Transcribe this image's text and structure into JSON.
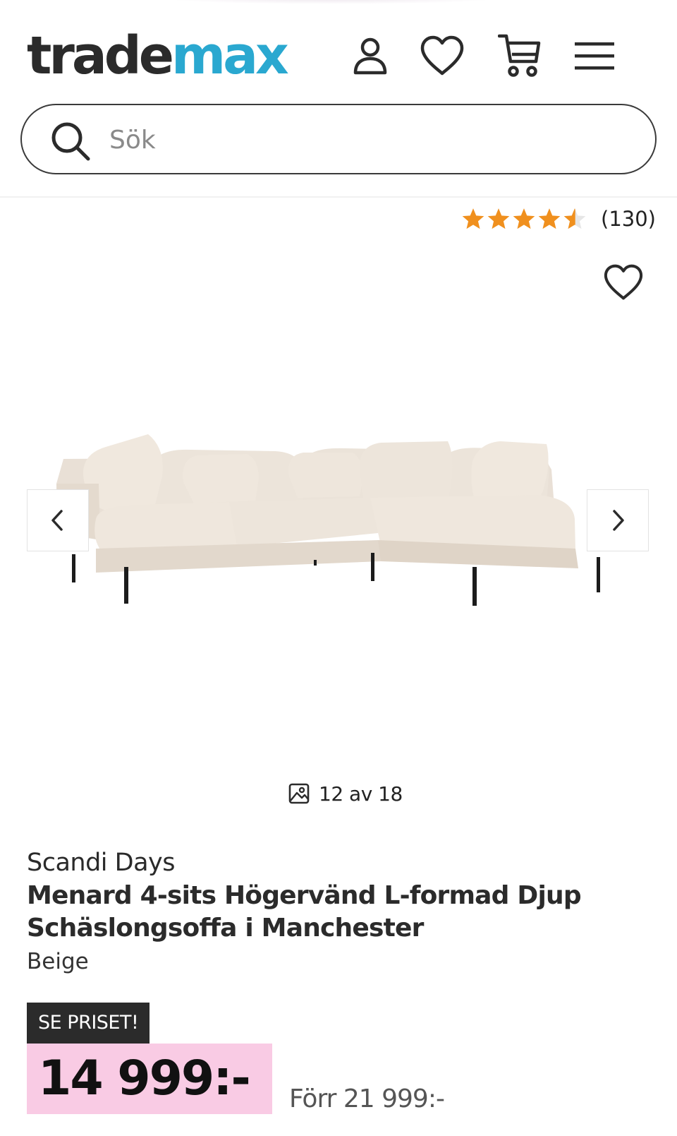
{
  "header": {
    "logo_part1": "trade",
    "logo_part2": "max",
    "icons": [
      "user-icon",
      "heart-icon",
      "cart-icon",
      "menu-icon"
    ]
  },
  "search": {
    "placeholder": "Sök",
    "value": ""
  },
  "rating": {
    "stars": 4.5,
    "count_label": "(130)"
  },
  "gallery": {
    "counter": "12 av 18"
  },
  "product": {
    "brand": "Scandi Days",
    "title": "Menard 4-sits Högervänd L-formad Djup Schäslongsoffa i Manchester",
    "color": "Beige",
    "badge": "SE PRISET!",
    "price": "14 999:-",
    "old_price": "Förr 21 999:-"
  },
  "colors": {
    "logo_dark": "#2b2b2b",
    "logo_accent": "#2aa8d0",
    "star": "#f0901e",
    "price_bg": "#f9cbe4",
    "badge_bg": "#2b2b2b"
  }
}
